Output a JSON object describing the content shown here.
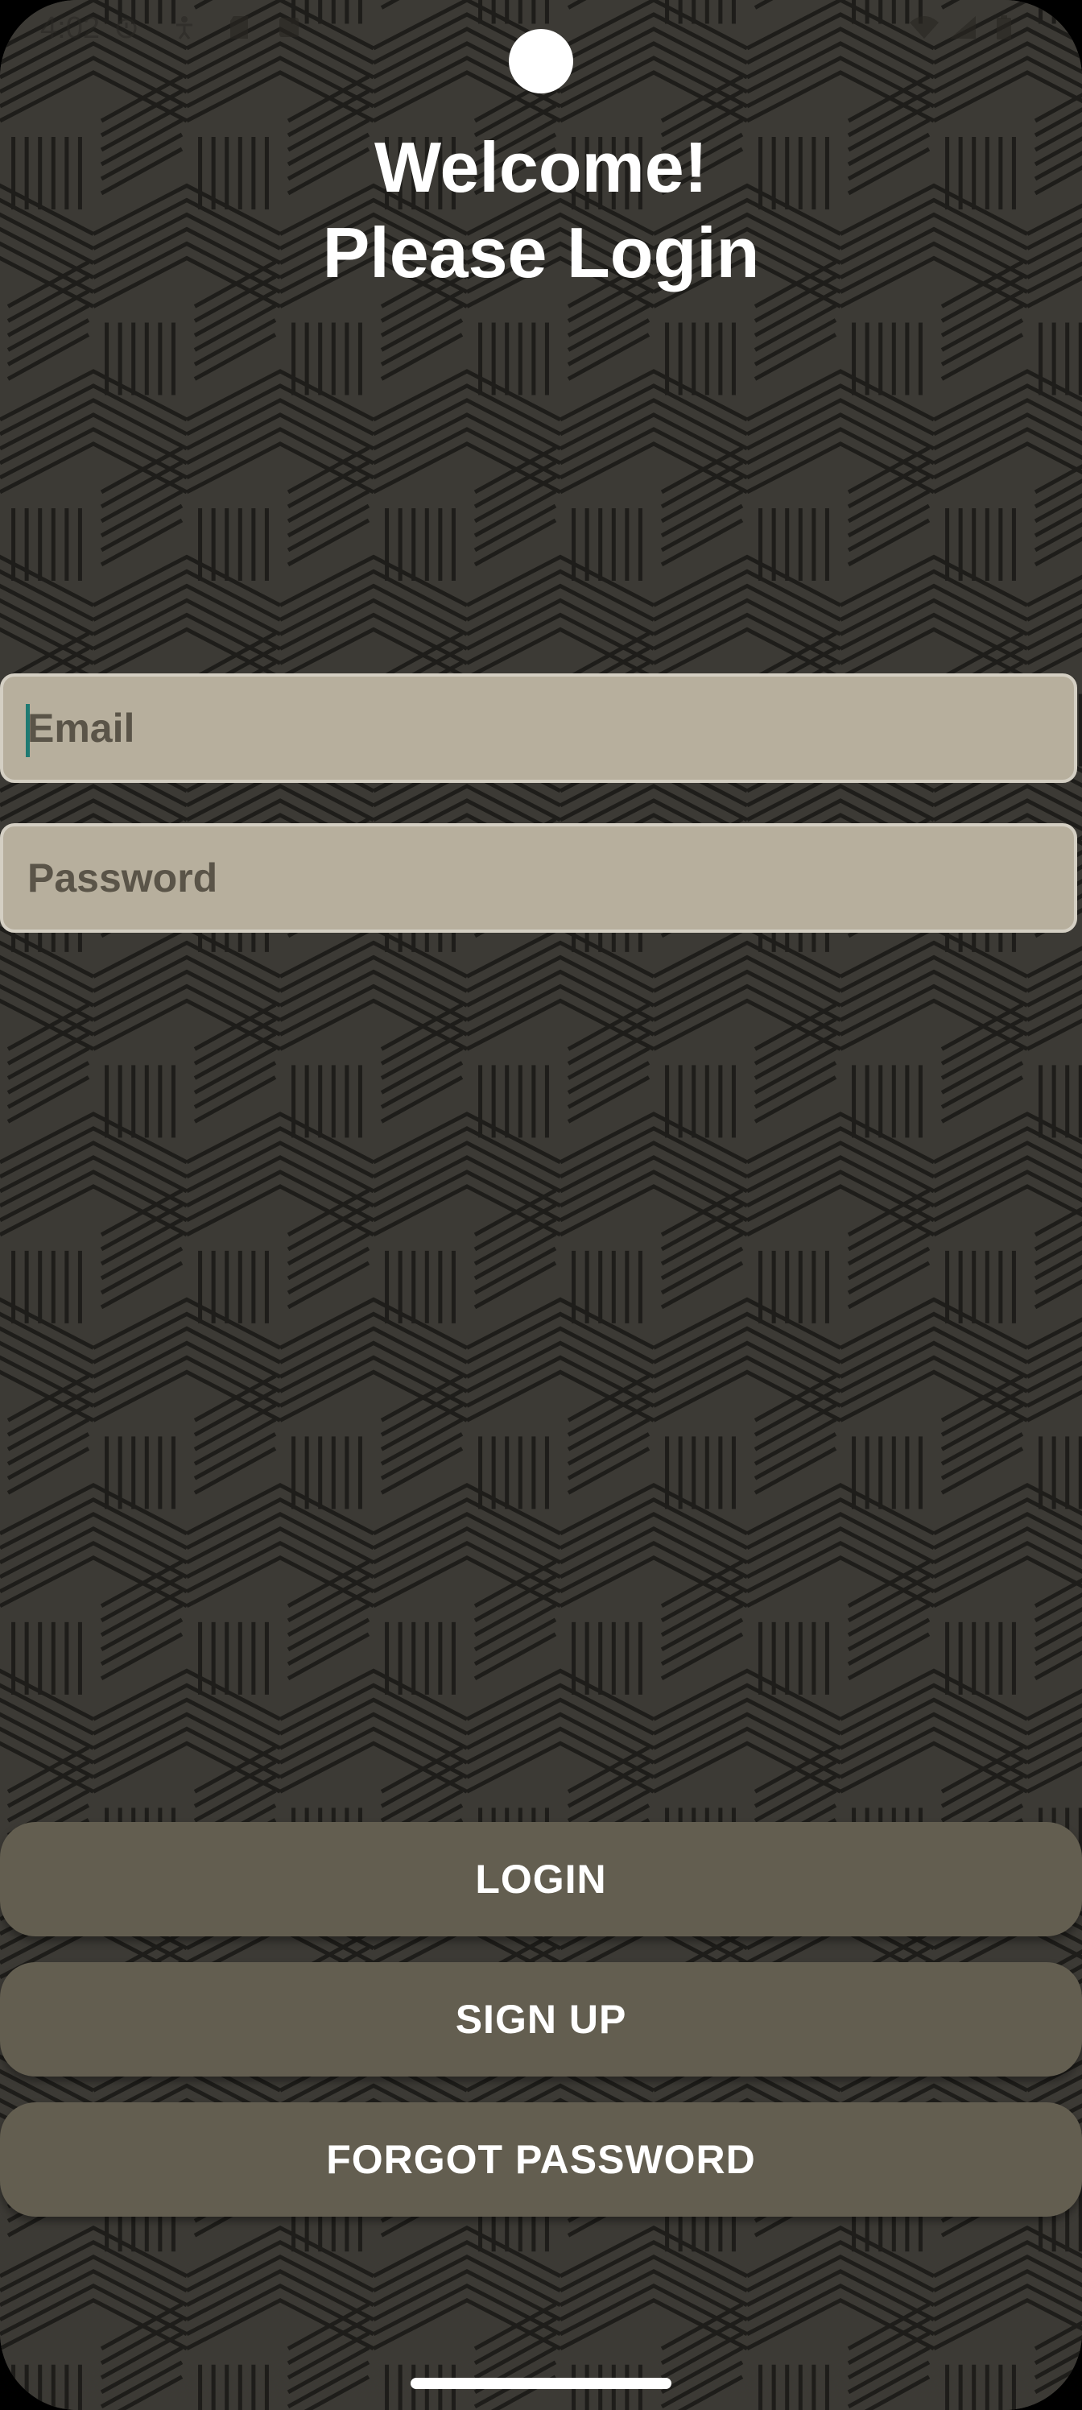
{
  "status_bar": {
    "time": "4:02"
  },
  "header": {
    "title_line1": "Welcome!",
    "title_line2": "Please Login"
  },
  "form": {
    "email_placeholder": "Email",
    "email_value": "",
    "password_placeholder": "Password",
    "password_value": ""
  },
  "buttons": {
    "login_label": "LOGIN",
    "signup_label": "SIGN UP",
    "forgot_label": "FORGOT PASSWORD"
  },
  "colors": {
    "background": "#3c3a35",
    "pattern_line": "#1e1d1a",
    "field_fill": "#b7af9d",
    "button_fill": "#635e50",
    "caret": "#1f7a72"
  },
  "icons": [
    "alarm-icon",
    "accessibility-icon",
    "sd-card-icon",
    "screen-icon",
    "wifi-icon",
    "signal-icon",
    "battery-icon"
  ]
}
